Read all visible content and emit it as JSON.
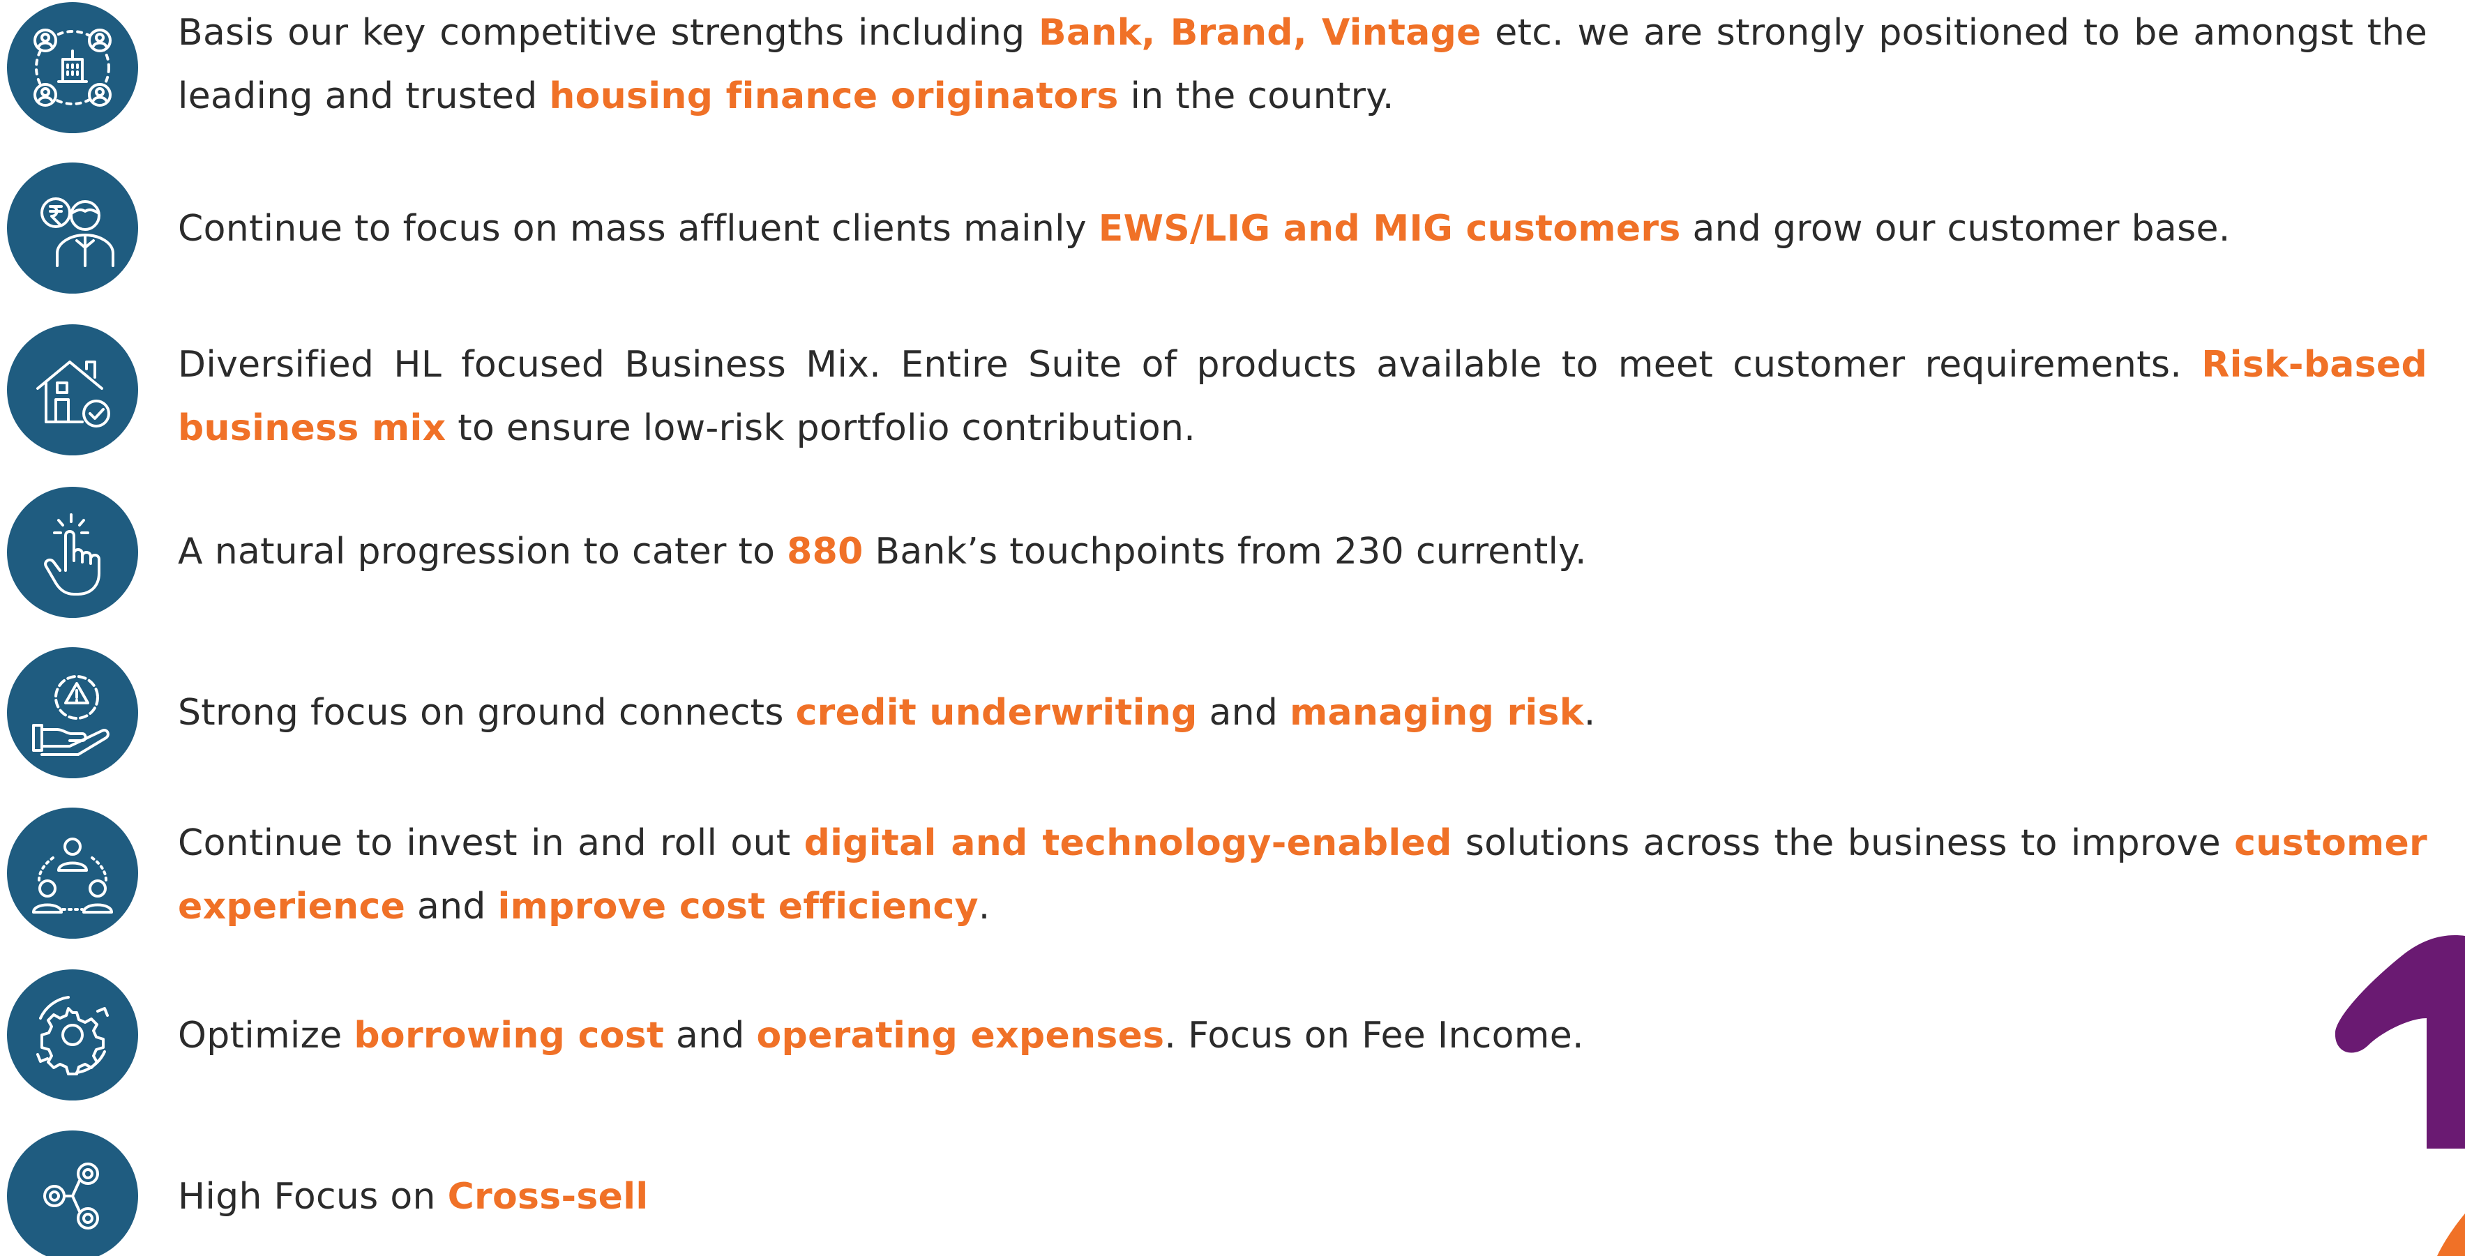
{
  "accent_color": "#f07127",
  "icon_color": "#1f5c80",
  "decoration_color": "#6a1a72",
  "items": [
    {
      "icon": "network-users-building-icon",
      "segments": [
        {
          "t": "Basis our key competitive strengths including ",
          "h": false
        },
        {
          "t": "Bank, Brand, Vintage",
          "h": true
        },
        {
          "t": " etc. we are strongly positioned to be amongst the leading and trusted ",
          "h": false
        },
        {
          "t": "housing finance originators",
          "h": true
        },
        {
          "t": " in the country.",
          "h": false
        }
      ]
    },
    {
      "icon": "rupee-customer-icon",
      "segments": [
        {
          "t": "Continue to focus on mass affluent clients mainly ",
          "h": false
        },
        {
          "t": "EWS/LIG and MIG customers",
          "h": true
        },
        {
          "t": " and grow our customer base.",
          "h": false
        }
      ]
    },
    {
      "icon": "house-check-icon",
      "segments": [
        {
          "t": "Diversified HL focused Business Mix. Entire Suite of products available to meet customer requirements. ",
          "h": false
        },
        {
          "t": "Risk-based business mix",
          "h": true
        },
        {
          "t": " to ensure low-risk portfolio contribution.",
          "h": false
        }
      ]
    },
    {
      "icon": "tap-hand-icon",
      "segments": [
        {
          "t": "A natural progression to cater to ",
          "h": false
        },
        {
          "t": "880",
          "h": true
        },
        {
          "t": " Bank’s touchpoints from 230 currently.",
          "h": false
        }
      ]
    },
    {
      "icon": "risk-gear-hand-icon",
      "segments": [
        {
          "t": "Strong focus on ground connects ",
          "h": false
        },
        {
          "t": "credit underwriting",
          "h": true
        },
        {
          "t": " and ",
          "h": false
        },
        {
          "t": "managing risk",
          "h": true
        },
        {
          "t": ".",
          "h": false
        }
      ]
    },
    {
      "icon": "team-network-icon",
      "segments": [
        {
          "t": "Continue to invest in and roll out ",
          "h": false
        },
        {
          "t": "digital and technology-enabled",
          "h": true
        },
        {
          "t": " solutions across the business to improve ",
          "h": false
        },
        {
          "t": "customer experience",
          "h": true
        },
        {
          "t": " and ",
          "h": false
        },
        {
          "t": "improve cost efficiency",
          "h": true
        },
        {
          "t": ".",
          "h": false
        }
      ]
    },
    {
      "icon": "gear-cycle-icon",
      "segments": [
        {
          "t": "Optimize ",
          "h": false
        },
        {
          "t": "borrowing cost",
          "h": true
        },
        {
          "t": " and ",
          "h": false
        },
        {
          "t": "operating expenses",
          "h": true
        },
        {
          "t": ". Focus on Fee Income.",
          "h": false
        }
      ]
    },
    {
      "icon": "share-nodes-icon",
      "segments": [
        {
          "t": "High Focus on ",
          "h": false
        },
        {
          "t": "Cross-sell",
          "h": true
        }
      ]
    }
  ]
}
